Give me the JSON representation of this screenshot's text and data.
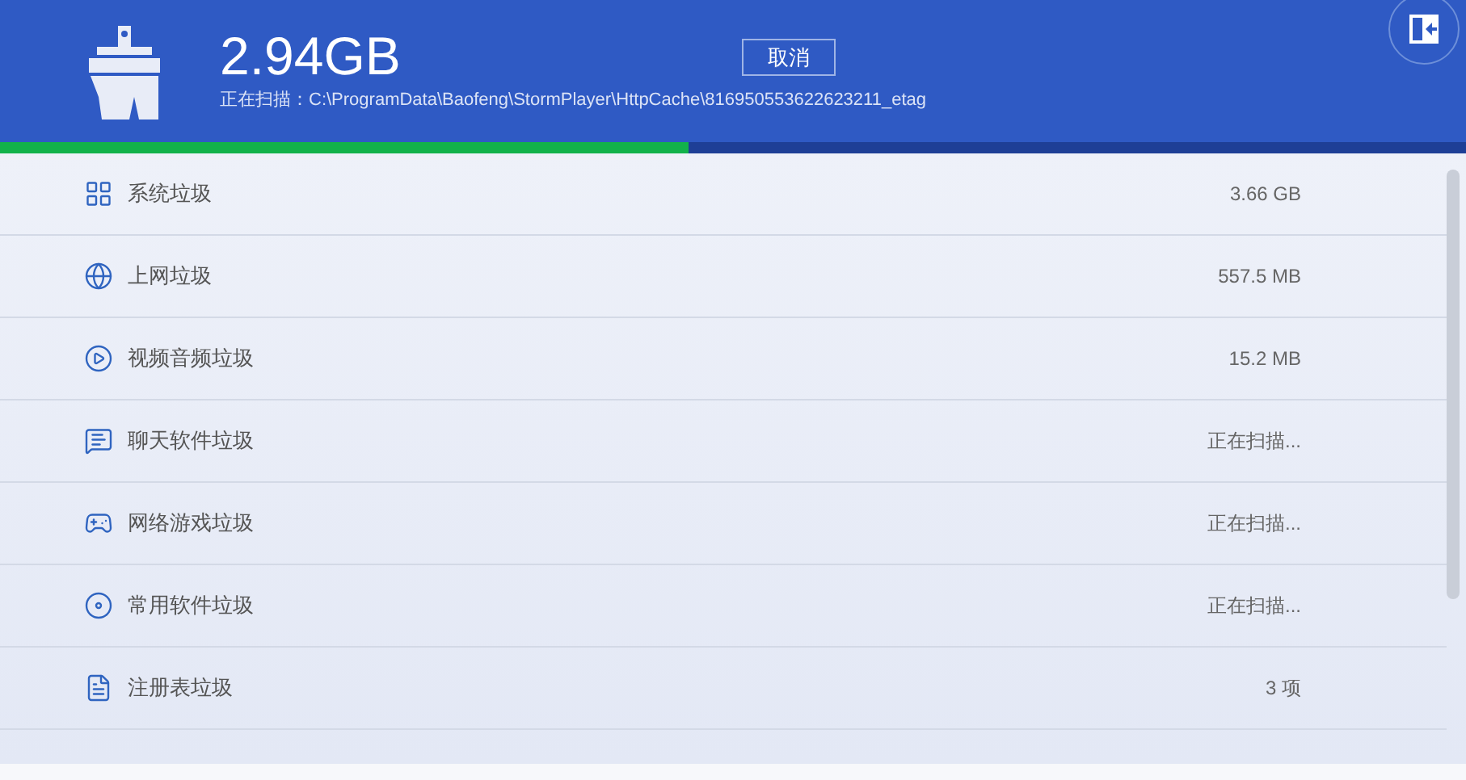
{
  "header": {
    "size": "2.94GB",
    "scan_label": "正在扫描：C:\\ProgramData\\Baofeng\\StormPlayer\\HttpCache\\816950553622623211_etag",
    "cancel_button": "取消"
  },
  "progress": {
    "level": 0.47
  },
  "items": [
    {
      "kind": "system",
      "name": "系统垃圾",
      "value": "3.66 GB"
    },
    {
      "kind": "web",
      "name": "上网垃圾",
      "value": "557.5 MB"
    },
    {
      "kind": "video",
      "name": "视频音频垃圾",
      "value": "15.2 MB"
    },
    {
      "kind": "chat",
      "name": "聊天软件垃圾",
      "value": "正在扫描..."
    },
    {
      "kind": "game",
      "name": "网络游戏垃圾",
      "value": "正在扫描..."
    },
    {
      "kind": "software",
      "name": "常用软件垃圾",
      "value": "正在扫描..."
    },
    {
      "kind": "registry",
      "name": "注册表垃圾",
      "value": "3 项"
    }
  ]
}
